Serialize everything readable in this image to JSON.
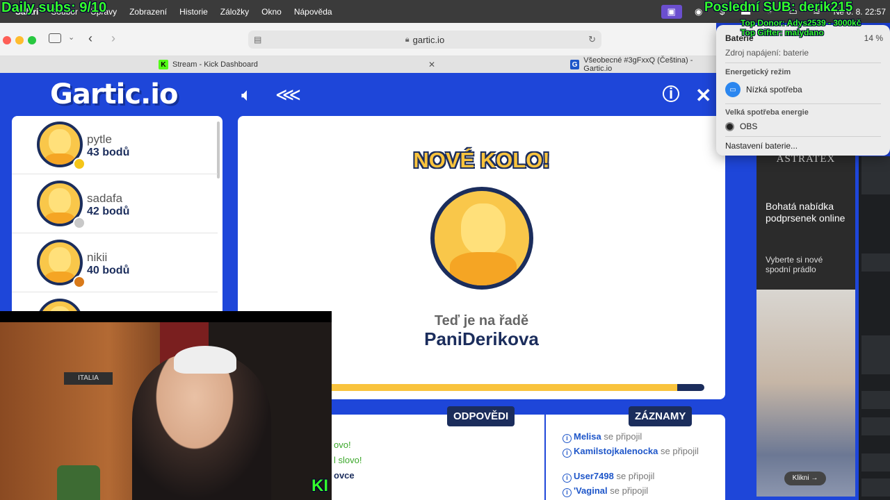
{
  "menubar": {
    "items": [
      "Safari",
      "Soubor",
      "Úpravy",
      "Zobrazení",
      "Historie",
      "Záložky",
      "Okno",
      "Nápověda"
    ],
    "clock": "Ne 6. 8.  22:57",
    "icons": [
      "screen-share-icon",
      "steam-icon",
      "dollar-icon",
      "bed-icon",
      "timer-icon",
      "battery-icon",
      "wifi-icon"
    ]
  },
  "overlays": {
    "daily_subs": "Daily subs: 9/10",
    "last_sub": "Poslední SUB: derik215",
    "top_donor": "Top Donor: Adys2539 - 3000kč",
    "top_gifter": "Top Gifter: malydano"
  },
  "browser": {
    "url": "gartic.io",
    "tabs": [
      {
        "title": "Stream - Kick Dashboard",
        "favicon": "K",
        "color": "#53fc18"
      },
      {
        "title": "Všeobecné #3gFxxQ (Čeština) - Gartic.io",
        "favicon": "G",
        "color": "#1e56c9"
      }
    ]
  },
  "game": {
    "logo": "Gartic.io",
    "players": [
      {
        "name": "pytle",
        "score": "43 bodů",
        "badge": "#f5c518"
      },
      {
        "name": "sadafa",
        "score": "42 bodů",
        "badge": "#c8c8c8"
      },
      {
        "name": "nikii",
        "score": "40 bodů",
        "badge": "#d97a1a"
      }
    ],
    "round_title": "NOVÉ KOLO!",
    "turn_label": "Teď je na řadě",
    "turn_player": "PaniDerikova",
    "progress": 0.93,
    "answers_label": "ODPOVĚDI",
    "records_label": "ZÁZNAMY",
    "answers": [
      "ovo!",
      "l slovo!",
      "ovce"
    ],
    "records": [
      {
        "user": "Melisa",
        "text": "se připojil"
      },
      {
        "user": "Kamilstojkalenocka",
        "text": "se připojil"
      },
      {
        "user": "User7498",
        "text": "se připojil"
      },
      {
        "user": "'Vaginal",
        "text": "se připojil"
      }
    ]
  },
  "battery": {
    "title": "Baterie",
    "percent": "14 %",
    "source": "Zdroj napájení: baterie",
    "energy_mode_label": "Energetický režim",
    "energy_mode_value": "Nízká spotřeba",
    "high_usage_label": "Velká spotřeba energie",
    "high_usage_app": "OBS",
    "settings": "Nastavení baterie..."
  },
  "ad": {
    "brand": "ASTRATEX",
    "headline": "Bohatá nabídka podprsenek online",
    "sub": "Vyberte si nové spodní prádlo",
    "cta": "Klikni →"
  },
  "webcam": {
    "sign": "ITALIA",
    "corner": "KI"
  }
}
